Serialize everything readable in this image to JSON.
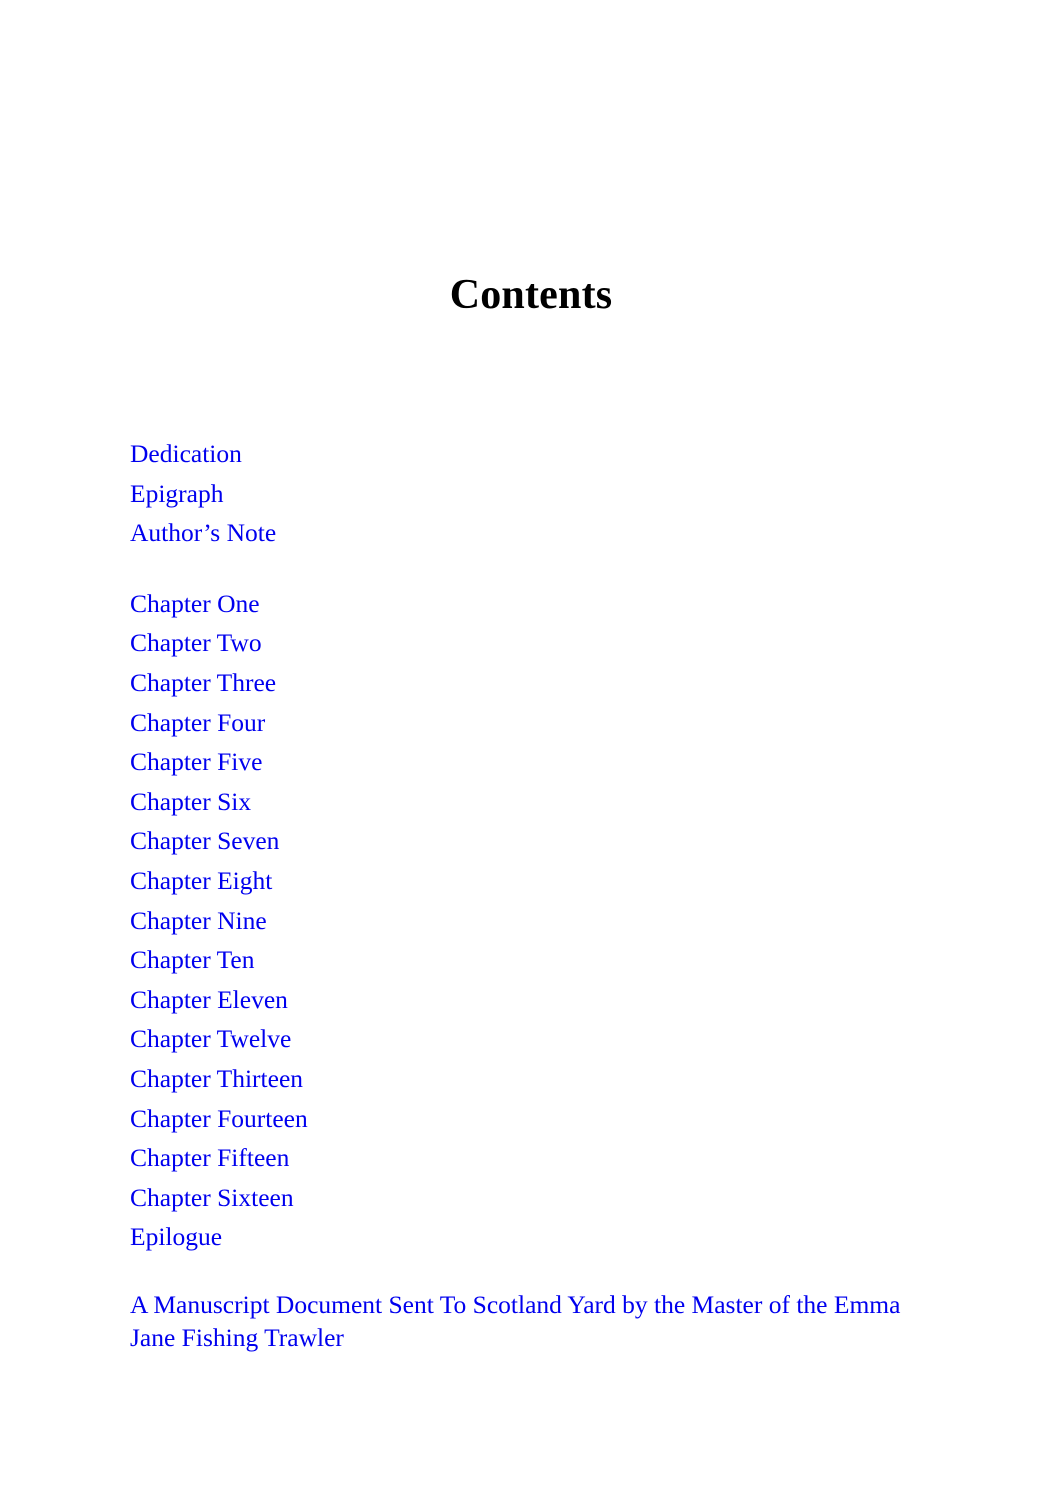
{
  "document": {
    "page_title": "Contents",
    "link_color": "#0000ee",
    "text_color": "#000000",
    "background_color": "#ffffff"
  },
  "toc": {
    "front_matter": [
      {
        "label": "Dedication"
      },
      {
        "label": "Epigraph"
      },
      {
        "label": "Author’s Note"
      }
    ],
    "chapters": [
      {
        "label": "Chapter One"
      },
      {
        "label": "Chapter Two"
      },
      {
        "label": "Chapter Three"
      },
      {
        "label": "Chapter Four"
      },
      {
        "label": "Chapter Five"
      },
      {
        "label": "Chapter Six"
      },
      {
        "label": "Chapter Seven"
      },
      {
        "label": "Chapter Eight"
      },
      {
        "label": "Chapter Nine"
      },
      {
        "label": "Chapter Ten"
      },
      {
        "label": "Chapter Eleven"
      },
      {
        "label": "Chapter Twelve"
      },
      {
        "label": "Chapter Thirteen"
      },
      {
        "label": "Chapter Fourteen"
      },
      {
        "label": "Chapter Fifteen"
      },
      {
        "label": "Chapter Sixteen"
      },
      {
        "label": "Epilogue"
      }
    ],
    "back_matter": [
      {
        "label": "A Manuscript Document Sent To Scotland Yard by the Master of the Emma Jane Fishing Trawler"
      }
    ]
  }
}
